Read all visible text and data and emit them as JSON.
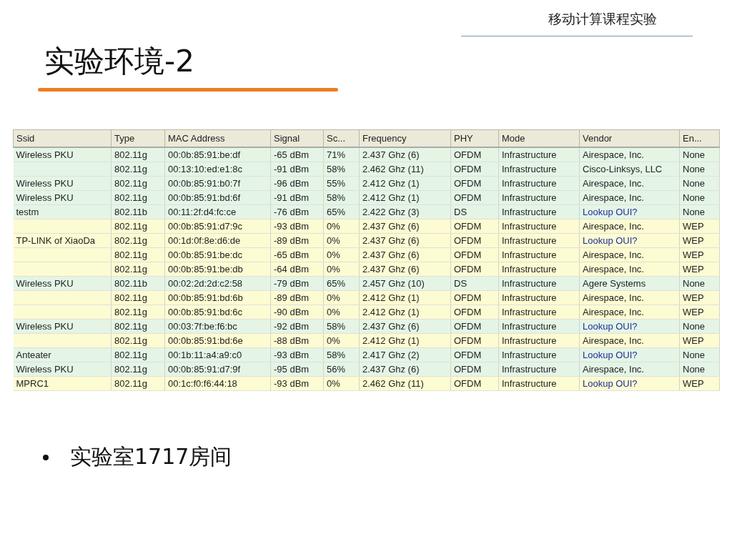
{
  "header": {
    "course": "移动计算课程实验"
  },
  "title": "实验环境-2",
  "table": {
    "columns": [
      "Ssid",
      "Type",
      "MAC Address",
      "Signal",
      "Sc...",
      "Frequency",
      "PHY",
      "Mode",
      "Vendor",
      "En..."
    ],
    "rows": [
      {
        "color": "#e4f5e6",
        "vendor_link": false,
        "cells": [
          "Wireless PKU",
          "802.11g",
          "00:0b:85:91:be:df",
          "-65 dBm",
          "71%",
          "2.437 Ghz (6)",
          "OFDM",
          "Infrastructure",
          "Airespace, Inc.",
          "None"
        ]
      },
      {
        "color": "#e4f5e6",
        "vendor_link": false,
        "cells": [
          "",
          "802.11g",
          "00:13:10:ed:e1:8c",
          "-91 dBm",
          "58%",
          "2.462 Ghz (11)",
          "OFDM",
          "Infrastructure",
          "Cisco-Linksys, LLC",
          "None"
        ]
      },
      {
        "color": "#e4f5e6",
        "vendor_link": false,
        "cells": [
          "Wireless PKU",
          "802.11g",
          "00:0b:85:91:b0:7f",
          "-96 dBm",
          "55%",
          "2.412 Ghz (1)",
          "OFDM",
          "Infrastructure",
          "Airespace, Inc.",
          "None"
        ]
      },
      {
        "color": "#e4f5e6",
        "vendor_link": false,
        "cells": [
          "Wireless PKU",
          "802.11g",
          "00:0b:85:91:bd:6f",
          "-91 dBm",
          "58%",
          "2.412 Ghz (1)",
          "OFDM",
          "Infrastructure",
          "Airespace, Inc.",
          "None"
        ]
      },
      {
        "color": "#e4f5e6",
        "vendor_link": true,
        "cells": [
          "testm",
          "802.11b",
          "00:11:2f:d4:fc:ce",
          "-76 dBm",
          "65%",
          "2.422 Ghz (3)",
          "DS",
          "Infrastructure",
          "Lookup OUI?",
          "None"
        ]
      },
      {
        "color": "#fdfbd2",
        "vendor_link": false,
        "cells": [
          "",
          "802.11g",
          "00:0b:85:91:d7:9c",
          "-93 dBm",
          "0%",
          "2.437 Ghz (6)",
          "OFDM",
          "Infrastructure",
          "Airespace, Inc.",
          "WEP"
        ]
      },
      {
        "color": "#fdfbd2",
        "vendor_link": true,
        "cells": [
          "TP-LINK of XiaoDa",
          "802.11g",
          "00:1d:0f:8e:d6:de",
          "-89 dBm",
          "0%",
          "2.437 Ghz (6)",
          "OFDM",
          "Infrastructure",
          "Lookup OUI?",
          "WEP"
        ]
      },
      {
        "color": "#fdfbd2",
        "vendor_link": false,
        "cells": [
          "",
          "802.11g",
          "00:0b:85:91:be:dc",
          "-65 dBm",
          "0%",
          "2.437 Ghz (6)",
          "OFDM",
          "Infrastructure",
          "Airespace, Inc.",
          "WEP"
        ]
      },
      {
        "color": "#fdfbd2",
        "vendor_link": false,
        "cells": [
          "",
          "802.11g",
          "00:0b:85:91:be:db",
          "-64 dBm",
          "0%",
          "2.437 Ghz (6)",
          "OFDM",
          "Infrastructure",
          "Airespace, Inc.",
          "WEP"
        ]
      },
      {
        "color": "#e4f5e6",
        "vendor_link": false,
        "cells": [
          "Wireless PKU",
          "802.11b",
          "00:02:2d:2d:c2:58",
          "-79 dBm",
          "65%",
          "2.457 Ghz (10)",
          "DS",
          "Infrastructure",
          "Agere Systems",
          "None"
        ]
      },
      {
        "color": "#fdfbd2",
        "vendor_link": false,
        "cells": [
          "",
          "802.11g",
          "00:0b:85:91:bd:6b",
          "-89 dBm",
          "0%",
          "2.412 Ghz (1)",
          "OFDM",
          "Infrastructure",
          "Airespace, Inc.",
          "WEP"
        ]
      },
      {
        "color": "#fdfbd2",
        "vendor_link": false,
        "cells": [
          "",
          "802.11g",
          "00:0b:85:91:bd:6c",
          "-90 dBm",
          "0%",
          "2.412 Ghz (1)",
          "OFDM",
          "Infrastructure",
          "Airespace, Inc.",
          "WEP"
        ]
      },
      {
        "color": "#e4f5e6",
        "vendor_link": true,
        "cells": [
          "Wireless PKU",
          "802.11g",
          "00:03:7f:be:f6:bc",
          "-92 dBm",
          "58%",
          "2.437 Ghz (6)",
          "OFDM",
          "Infrastructure",
          "Lookup OUI?",
          "None"
        ]
      },
      {
        "color": "#fdfbd2",
        "vendor_link": false,
        "cells": [
          "",
          "802.11g",
          "00:0b:85:91:bd:6e",
          "-88 dBm",
          "0%",
          "2.412 Ghz (1)",
          "OFDM",
          "Infrastructure",
          "Airespace, Inc.",
          "WEP"
        ]
      },
      {
        "color": "#e4f5e6",
        "vendor_link": true,
        "cells": [
          "Anteater",
          "802.11g",
          "00:1b:11:a4:a9:c0",
          "-93 dBm",
          "58%",
          "2.417 Ghz (2)",
          "OFDM",
          "Infrastructure",
          "Lookup OUI?",
          "None"
        ]
      },
      {
        "color": "#e4f5e6",
        "vendor_link": false,
        "cells": [
          "Wireless PKU",
          "802.11g",
          "00:0b:85:91:d7:9f",
          "-95 dBm",
          "56%",
          "2.437 Ghz (6)",
          "OFDM",
          "Infrastructure",
          "Airespace, Inc.",
          "None"
        ]
      },
      {
        "color": "#fdfbd2",
        "vendor_link": true,
        "cells": [
          "MPRC1",
          "802.11g",
          "00:1c:f0:f6:44:18",
          "-93 dBm",
          "0%",
          "2.462 Ghz (11)",
          "OFDM",
          "Infrastructure",
          "Lookup OUI?",
          "WEP"
        ]
      }
    ]
  },
  "bullets": [
    "实验室1717房间"
  ]
}
